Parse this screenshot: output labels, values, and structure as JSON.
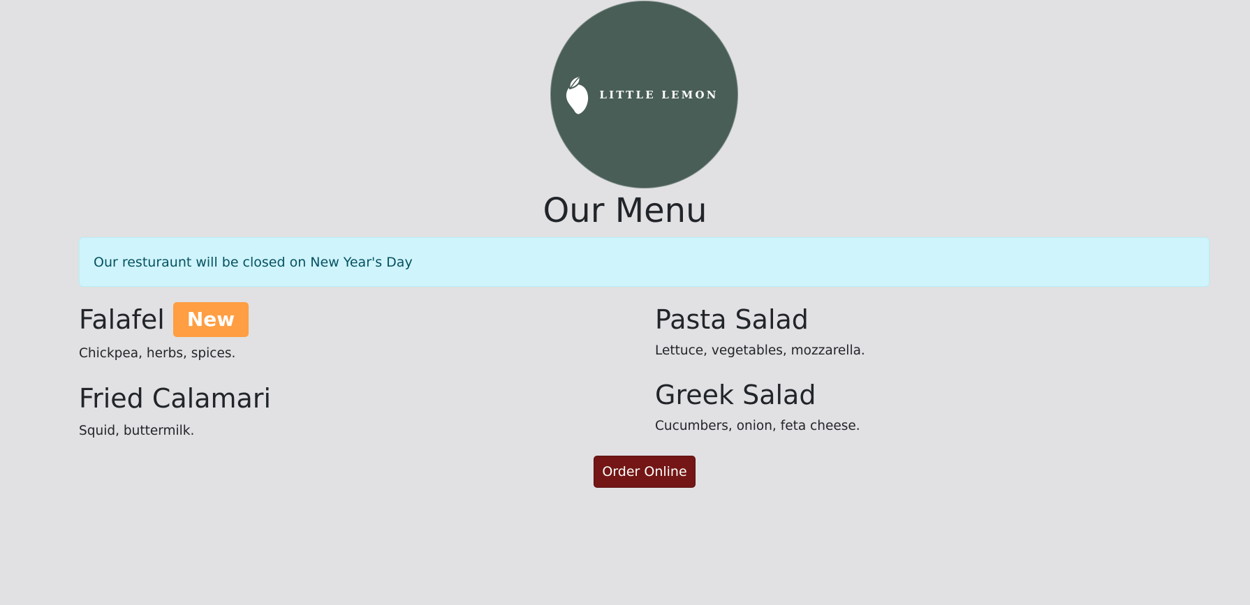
{
  "logo": {
    "text": "LITTLE LEMON",
    "background_color": "#495e57",
    "icon": "lemon-icon"
  },
  "page_title": "Our Menu",
  "alert": {
    "message": "Our resturaunt will be closed on New Year's Day",
    "background_color": "#cff4fc",
    "text_color": "#055160"
  },
  "menu": {
    "items": [
      {
        "name": "Falafel",
        "badge": "New",
        "description": "Chickpea, herbs, spices."
      },
      {
        "name": "Fried Calamari",
        "description": "Squid, buttermilk."
      },
      {
        "name": "Pasta Salad",
        "description": "Lettuce, vegetables, mozzarella."
      },
      {
        "name": "Greek Salad",
        "description": "Cucumbers, onion, feta cheese."
      }
    ],
    "badge_color": "#ff9e42"
  },
  "order_button": {
    "label": "Order Online",
    "color": "#731615"
  },
  "page_background": "#e1e0e2"
}
